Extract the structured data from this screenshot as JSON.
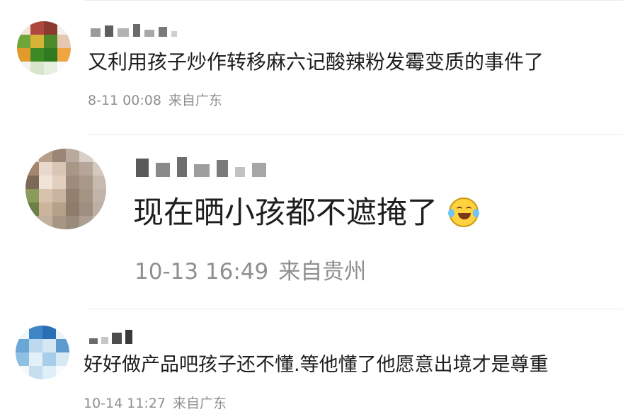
{
  "comments": [
    {
      "text": "又利用孩子炒作转移麻六记酸辣粉发霉变质的事件了",
      "time": "8-11 00:08",
      "location": "来自广东"
    },
    {
      "text": "现在晒小孩都不遮掩了",
      "emoji": "crying-laughing-emoji",
      "time": "10-13 16:49",
      "location": "来自贵州"
    },
    {
      "text": "好好做产品吧孩子还不懂.等他懂了他愿意出境才是尊重",
      "time": "10-14 11:27",
      "location": "来自广东"
    }
  ],
  "colors": {
    "text": "#1e1e1e",
    "meta": "#8f8f8f",
    "divider": "#ececec",
    "emoji_face": "#ffd23f"
  }
}
